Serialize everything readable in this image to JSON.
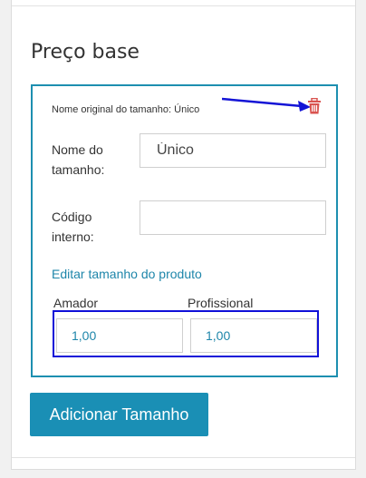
{
  "section": {
    "title": "Preço base"
  },
  "size": {
    "original_name_text": "Nome original do tamanho: Único",
    "name_label_line1": "Nome do",
    "name_label_line2": "tamanho:",
    "name_value": "Único",
    "code_label_line1": "Código",
    "code_label_line2": "interno:",
    "code_value": "",
    "edit_link": "Editar tamanho do produto",
    "prices": [
      {
        "label": "Amador",
        "value": "1,00"
      },
      {
        "label": "Profissional",
        "value": "1,00"
      }
    ],
    "delete_icon": "trash-icon"
  },
  "actions": {
    "add_size_label": "Adicionar Tamanho"
  },
  "annotations": {
    "arrow_color": "#1414d6",
    "highlight_color": "#1010d8"
  },
  "colors": {
    "accent": "#1a8fb5",
    "delete": "#d9534f"
  }
}
